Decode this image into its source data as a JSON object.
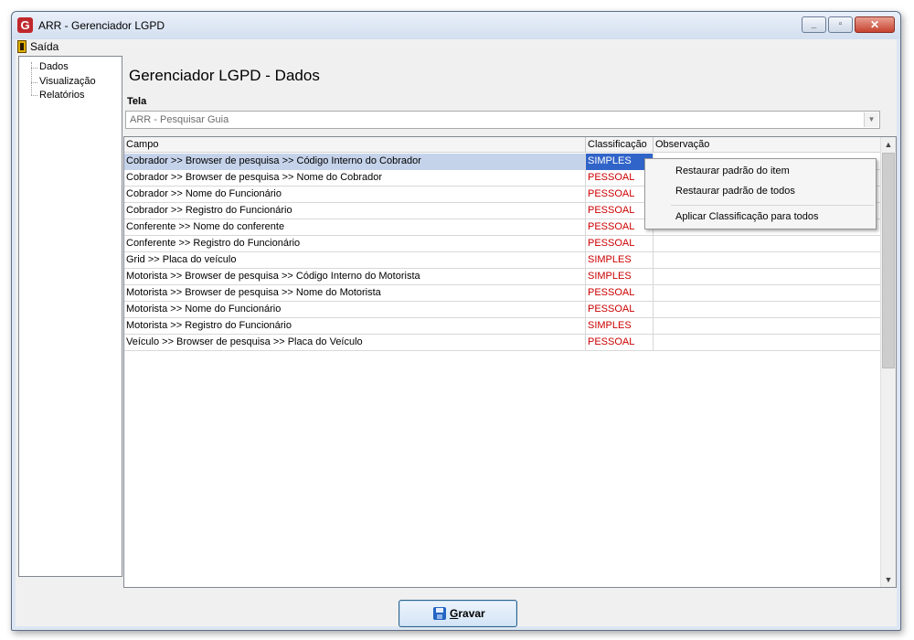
{
  "window": {
    "title": "ARR - Gerenciador LGPD",
    "app_icon_letter": "G"
  },
  "menu": {
    "exit_label": "Saída"
  },
  "tree": {
    "items": [
      "Dados",
      "Visualização",
      "Relatórios"
    ]
  },
  "header": {
    "title": "Gerenciador LGPD - Dados"
  },
  "tela": {
    "label": "Tela",
    "value": "ARR - Pesquisar Guia"
  },
  "grid": {
    "columns": [
      "Campo",
      "Classificação",
      "Observação"
    ],
    "rows": [
      {
        "campo": "Cobrador >> Browser de pesquisa >> Código Interno do Cobrador",
        "classificacao": "SIMPLES",
        "observacao": ""
      },
      {
        "campo": "Cobrador >> Browser de pesquisa >> Nome do Cobrador",
        "classificacao": "PESSOAL",
        "observacao": ""
      },
      {
        "campo": "Cobrador >> Nome do Funcionário",
        "classificacao": "PESSOAL",
        "observacao": ""
      },
      {
        "campo": "Cobrador >> Registro do Funcionário",
        "classificacao": "PESSOAL",
        "observacao": ""
      },
      {
        "campo": "Conferente >> Nome do conferente",
        "classificacao": "PESSOAL",
        "observacao": ""
      },
      {
        "campo": "Conferente >> Registro do Funcionário",
        "classificacao": "PESSOAL",
        "observacao": ""
      },
      {
        "campo": "Grid >> Placa do veículo",
        "classificacao": "SIMPLES",
        "observacao": ""
      },
      {
        "campo": "Motorista >> Browser de pesquisa >> Código Interno do Motorista",
        "classificacao": "SIMPLES",
        "observacao": ""
      },
      {
        "campo": "Motorista >> Browser de pesquisa >> Nome do Motorista",
        "classificacao": "PESSOAL",
        "observacao": ""
      },
      {
        "campo": "Motorista >> Nome do Funcionário",
        "classificacao": "PESSOAL",
        "observacao": ""
      },
      {
        "campo": "Motorista >> Registro do Funcionário",
        "classificacao": "SIMPLES",
        "observacao": ""
      },
      {
        "campo": "Veículo >> Browser de pesquisa >> Placa do Veículo",
        "classificacao": "PESSOAL",
        "observacao": ""
      }
    ]
  },
  "context_menu": {
    "items": [
      "Restaurar padrão do item",
      "Restaurar padrão de todos",
      "Aplicar Classificação para todos"
    ]
  },
  "actions": {
    "save_hotkey": "G",
    "save_rest": "ravar"
  },
  "colors": {
    "pessoal": "#cc0000",
    "simples": "#cc0000",
    "selected_class_bg": "#3164c8"
  }
}
